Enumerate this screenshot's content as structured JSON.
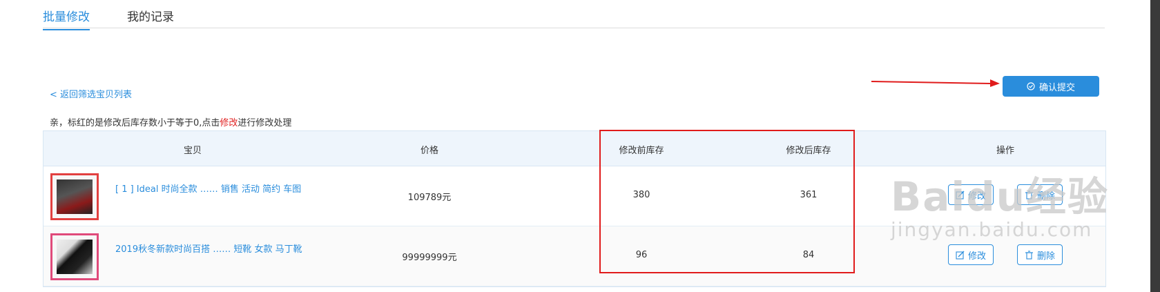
{
  "tabs": [
    {
      "label": "批量修改",
      "active": true
    },
    {
      "label": "我的记录",
      "active": false
    }
  ],
  "back_link": "< 返回筛选宝贝列表",
  "submit_button": {
    "label": "确认提交",
    "icon": "check-circle-icon"
  },
  "notice": {
    "prefix": "亲，标红的是修改后库存数小于等于0,点击",
    "highlight": "修改",
    "suffix": "进行修改处理"
  },
  "table": {
    "headers": [
      "宝贝",
      "价格",
      "修改前库存",
      "修改后库存",
      "操作"
    ],
    "rows": [
      {
        "title": "[ 1 ] Ideal 时尚全款 …… 销售 活动 简约 车图",
        "price": "109789元",
        "stock_before": "380",
        "stock_after": "361",
        "edit_label": "修改",
        "delete_label": "删除"
      },
      {
        "title": "2019秋冬新款时尚百搭 …… 短靴 女款 马丁靴",
        "price": "99999999元",
        "stock_before": "96",
        "stock_after": "84",
        "edit_label": "修改",
        "delete_label": "删除"
      }
    ]
  },
  "watermark": {
    "main": "Baidu经验",
    "sub": "jingyan.baidu.com"
  },
  "colors": {
    "accent": "#2a8ddc",
    "annotation": "#e01b1b"
  }
}
